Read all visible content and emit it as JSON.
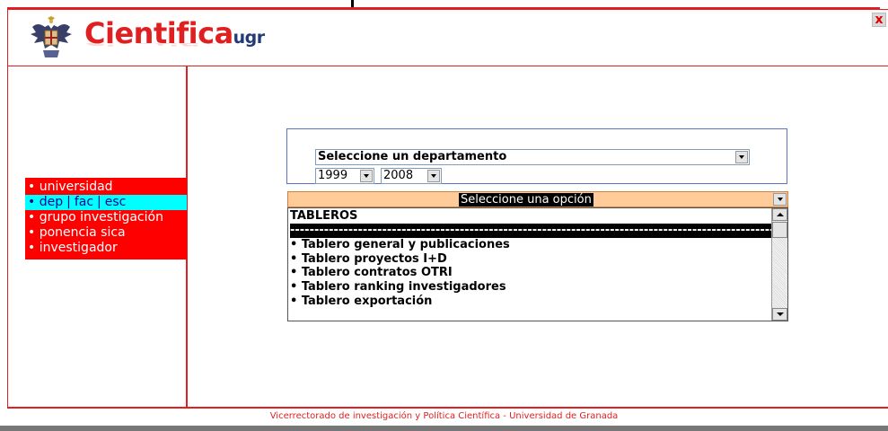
{
  "window": {
    "close_label": "x"
  },
  "header": {
    "logo_main": "Cientifica",
    "logo_suffix": "ugr",
    "logo_reflection": "Cientifica",
    "seal_icon": "coat-of-arms-icon"
  },
  "sidebar": {
    "items": [
      {
        "label": "universidad",
        "bullet": "•",
        "active": false
      },
      {
        "label": "dep",
        "label2": "fac",
        "label3": "esc",
        "separator": "|",
        "bullet": "•",
        "active": true
      },
      {
        "label": "grupo investigación",
        "bullet": "•",
        "active": false
      },
      {
        "label": "ponencia sica",
        "bullet": "•",
        "active": false
      },
      {
        "label": "investigador",
        "bullet": "•",
        "active": false
      }
    ]
  },
  "filters": {
    "department_select": "Seleccione un departamento",
    "year_from": "1999",
    "year_to": "2008"
  },
  "options": {
    "header": "Seleccione una opción",
    "list": {
      "group_title": "TABLEROS",
      "selected_separator": "-----------------------------------------------------------------------------------------------------------",
      "items": [
        "• Tablero general y publicaciones",
        "• Tablero proyectos I+D",
        "• Tablero contratos OTRI",
        "• Tablero ranking investigadores",
        "• Tablero exportación"
      ]
    }
  },
  "footer": {
    "text": "Vicerrectorado de investigación y Política Científica - Universidad de Granada"
  },
  "colors": {
    "brand_red": "#e02020",
    "menu_bg": "#ff0000",
    "menu_active": "#00ffff",
    "option_header_bg": "#ffcc99",
    "logo_blue": "#223a78"
  }
}
